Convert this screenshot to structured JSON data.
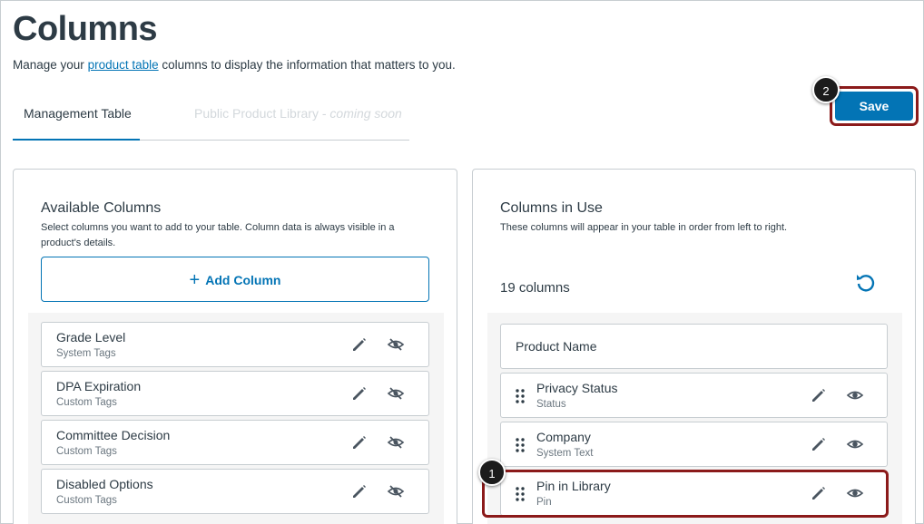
{
  "header": {
    "title": "Columns",
    "subtitle_before": "Manage your ",
    "subtitle_link": "product table",
    "subtitle_after": " columns to display the information that matters to you."
  },
  "tabs": [
    {
      "label": "Management Table",
      "active": true
    },
    {
      "label": "Public Product Library - ",
      "suffix": "coming soon",
      "disabled": true
    }
  ],
  "save": {
    "label": "Save",
    "callout": "2"
  },
  "available": {
    "title": "Available Columns",
    "description": "Select columns you want to add to your table. Column data is always visible in a product's details.",
    "add_label": "Add Column",
    "items": [
      {
        "name": "Grade Level",
        "type": "System Tags"
      },
      {
        "name": "DPA Expiration",
        "type": "Custom Tags"
      },
      {
        "name": "Committee Decision",
        "type": "Custom Tags"
      },
      {
        "name": "Disabled Options",
        "type": "Custom Tags"
      }
    ]
  },
  "in_use": {
    "title": "Columns in Use",
    "description": "These columns will appear in your table in order from left to right.",
    "count": "19 columns",
    "fixed_item": "Product Name",
    "items": [
      {
        "name": "Privacy Status",
        "type": "Status"
      },
      {
        "name": "Company",
        "type": "System Text"
      },
      {
        "name": "Pin in Library",
        "type": "Pin"
      }
    ],
    "callout": "1"
  },
  "colors": {
    "accent": "#0374b5",
    "highlight": "#8b1a1a",
    "text": "#2d3b45"
  }
}
